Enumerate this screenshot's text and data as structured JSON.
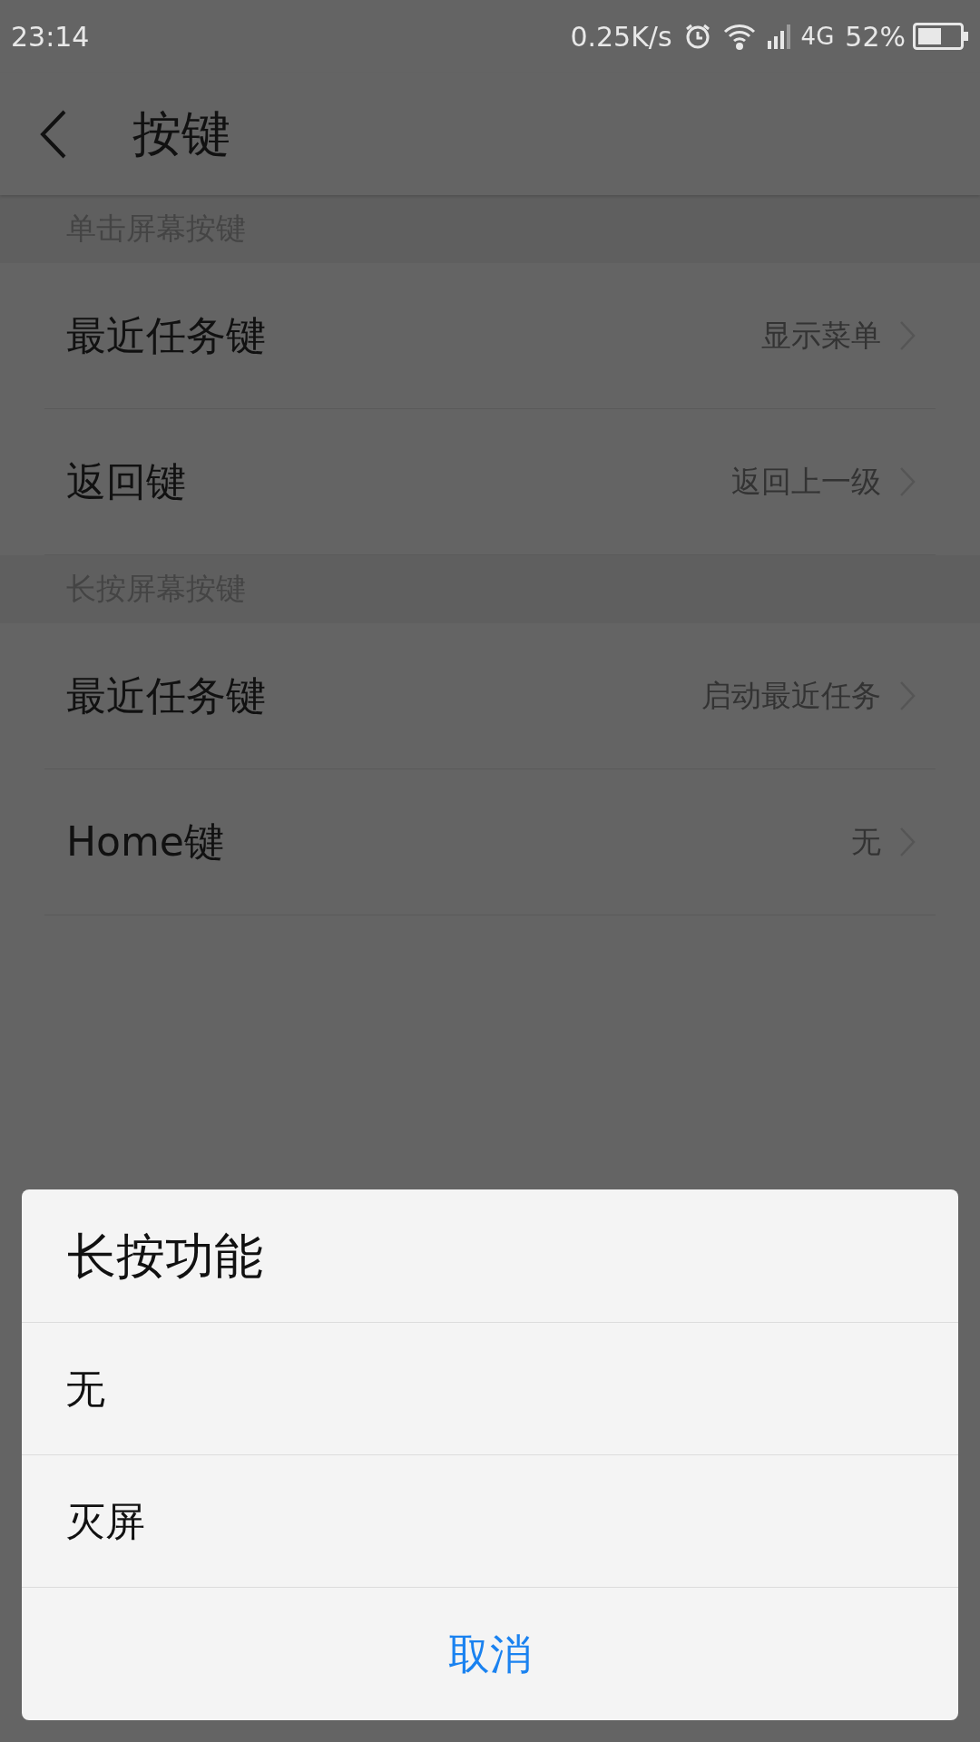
{
  "status_bar": {
    "time": "23:14",
    "speed": "0.25K/s",
    "network": "4G",
    "battery": "52%"
  },
  "header": {
    "title": "按键"
  },
  "sections": [
    {
      "title": "单击屏幕按键",
      "rows": [
        {
          "label": "最近任务键",
          "value": "显示菜单"
        },
        {
          "label": "返回键",
          "value": "返回上一级"
        }
      ]
    },
    {
      "title": "长按屏幕按键",
      "rows": [
        {
          "label": "最近任务键",
          "value": "启动最近任务"
        },
        {
          "label": "Home键",
          "value": "无"
        }
      ]
    }
  ],
  "dialog": {
    "title": "长按功能",
    "options": [
      "无",
      "灭屏"
    ],
    "cancel": "取消"
  }
}
